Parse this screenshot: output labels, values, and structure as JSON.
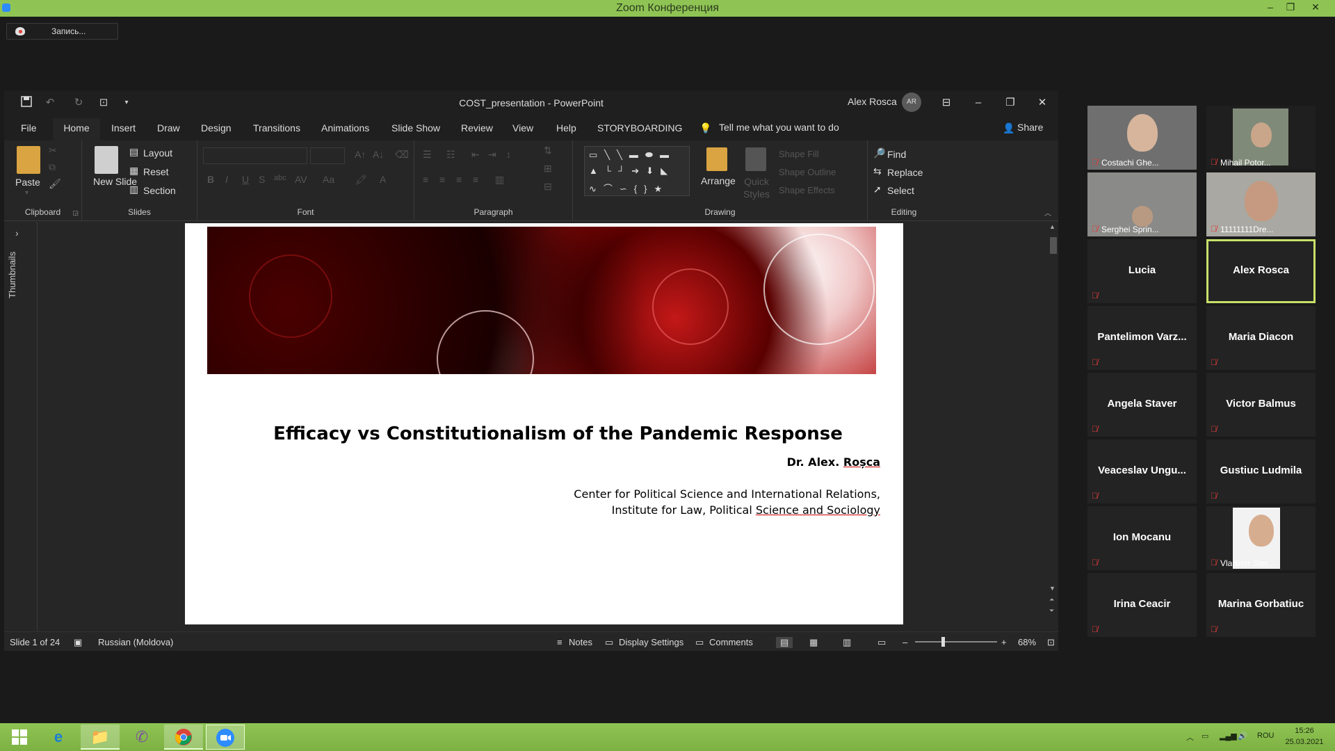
{
  "zoom": {
    "window_title": "Zoom Конференция",
    "recording_label": "Запись...",
    "window_controls": [
      "–",
      "❐",
      "✕"
    ]
  },
  "powerpoint": {
    "document_title": "COST_presentation  -  PowerPoint",
    "user_name": "Alex Rosca",
    "user_initials": "AR",
    "tabs": [
      "File",
      "Home",
      "Insert",
      "Draw",
      "Design",
      "Transitions",
      "Animations",
      "Slide Show",
      "Review",
      "View",
      "Help",
      "STORYBOARDING"
    ],
    "active_tab": "Home",
    "tell_me": "Tell me what you want to do",
    "share_label": "Share",
    "ribbon": {
      "clipboard": {
        "label": "Clipboard",
        "paste": "Paste"
      },
      "slides": {
        "label": "Slides",
        "new_slide": "New Slide",
        "layout": "Layout",
        "reset": "Reset",
        "section": "Section"
      },
      "font": {
        "label": "Font"
      },
      "paragraph": {
        "label": "Paragraph"
      },
      "drawing": {
        "label": "Drawing",
        "arrange": "Arrange",
        "quick_styles": "Quick Styles",
        "shape_fill": "Shape Fill",
        "shape_outline": "Shape Outline",
        "shape_effects": "Shape Effects"
      },
      "editing": {
        "label": "Editing",
        "find": "Find",
        "replace": "Replace",
        "select": "Select"
      }
    },
    "thumbnails_label": "Thumbnails",
    "slide": {
      "title": "Efficacy vs Constitutionalism of the Pandemic Response",
      "author_prefix": "Dr. Alex. ",
      "author_surname": "Roșca",
      "org_line1": "Center for Political Science and International Relations,",
      "org_line2_prefix": "Institute for Law, Political ",
      "org_line2_underlined": "Science and Sociology"
    },
    "status": {
      "slide_info": "Slide 1 of 24",
      "language": "Russian (Moldova)",
      "notes": "Notes",
      "display_settings": "Display Settings",
      "comments": "Comments",
      "zoom": "68%"
    }
  },
  "participants": [
    {
      "name": "Costachi Ghe...",
      "video": true,
      "muted": true
    },
    {
      "name": "Mihail Potor...",
      "video": true,
      "muted": true
    },
    {
      "name": "Serghei Sprin...",
      "video": true,
      "muted": true
    },
    {
      "name": "11111111Dre...",
      "video": true,
      "muted": true
    },
    {
      "name": "Lucia",
      "video": false,
      "muted": true
    },
    {
      "name": "Alex Rosca",
      "video": false,
      "muted": false,
      "active": true
    },
    {
      "name": "Pantelimon  Varz...",
      "video": false,
      "muted": true
    },
    {
      "name": "Maria Diacon",
      "video": false,
      "muted": true
    },
    {
      "name": "Angela Staver",
      "video": false,
      "muted": true
    },
    {
      "name": "Victor Balmus",
      "video": false,
      "muted": true
    },
    {
      "name": "Veaceslav  Ungu...",
      "video": false,
      "muted": true
    },
    {
      "name": "Gustiuc Ludmila",
      "video": false,
      "muted": true
    },
    {
      "name": "Ion Mocanu",
      "video": false,
      "muted": true
    },
    {
      "name": "Vladimir Ster...",
      "video": true,
      "muted": true
    },
    {
      "name": "Irina Ceacir",
      "video": false,
      "muted": true
    },
    {
      "name": "Marina Gorbatiuc",
      "video": false,
      "muted": true
    }
  ],
  "taskbar": {
    "language": "ROU",
    "time": "15:26",
    "date": "25.03.2021"
  },
  "colors": {
    "zoom_green": "#8fc454",
    "active_speaker": "#c8e06a",
    "mute_red": "#e23c3c"
  }
}
